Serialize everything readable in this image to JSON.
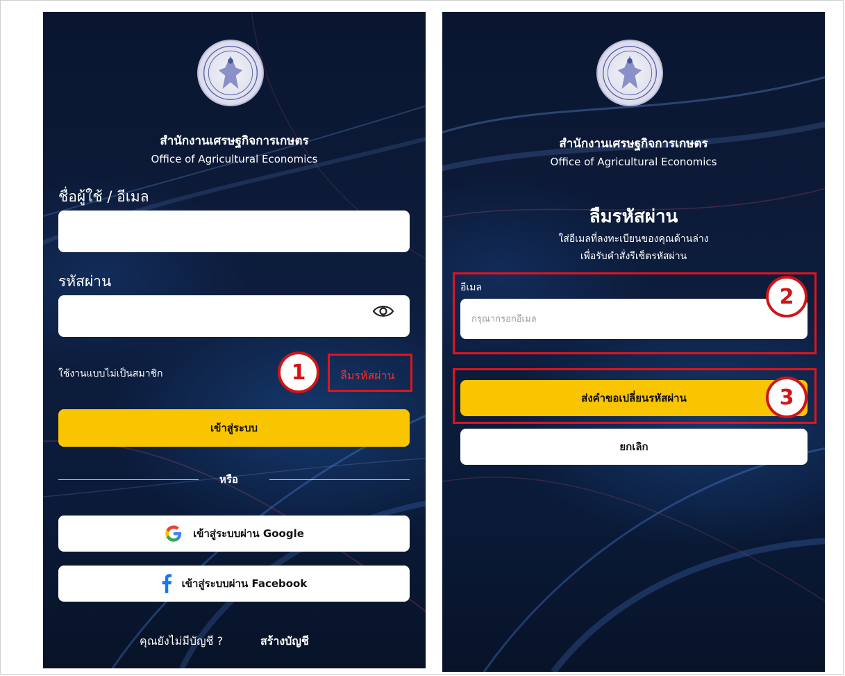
{
  "org": {
    "name_th": "สำนักงานเศรษฐกิจการเกษตร",
    "name_en": "Office of Agricultural Economics"
  },
  "login": {
    "username_label": "ชื่อผู้ใช้ / อีเมล",
    "password_label": "รหัสผ่าน",
    "guest_link": "ใช้งานแบบไม่เป็นสมาชิก",
    "forgot_link": "ลืมรหัสผ่าน",
    "login_button": "เข้าสู่ระบบ",
    "or_text": "หรือ",
    "google_button": "เข้าสู่ระบบผ่าน Google",
    "facebook_button": "เข้าสู่ระบบผ่าน Facebook",
    "no_account_text": "คุณยังไม่มีบัญชี ?",
    "create_account_link": "สร้างบัญชี"
  },
  "forgot": {
    "title": "ลืมรหัสผ่าน",
    "desc_line1": "ใส่อีเมลที่ลงทะเบียนของคุณด้านล่าง",
    "desc_line2": "เพื่อรับคำสั่งรีเซ็ตรหัสผ่าน",
    "email_label": "อีเมล",
    "email_placeholder": "กรุณากรอกอีเมล",
    "submit_button": "ส่งคำขอเปลี่ยนรหัสผ่าน",
    "cancel_button": "ยกเลิก"
  },
  "annotations": {
    "step1": "1",
    "step2": "2",
    "step3": "3",
    "highlight_color": "#e0141e"
  },
  "colors": {
    "primary_button": "#f9c400",
    "background": "#0d1d3d",
    "forgot_link": "#ff2b2b"
  },
  "icons": {
    "seal": "royal-seal-icon",
    "eye": "eye-icon",
    "google": "google-g-icon",
    "facebook": "facebook-f-icon"
  }
}
